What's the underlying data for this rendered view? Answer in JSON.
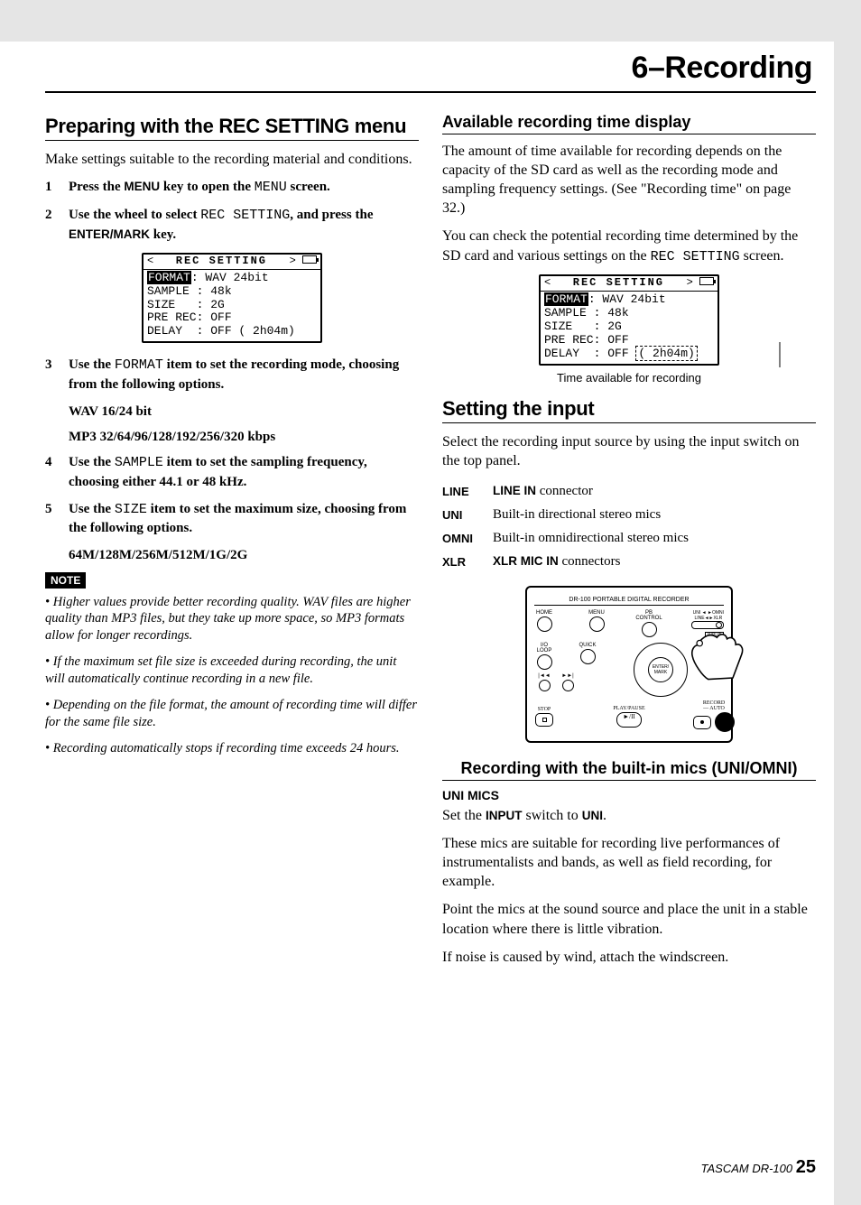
{
  "chapter": "6–Recording",
  "left": {
    "h2": "Preparing with the REC SETTING menu",
    "intro": "Make settings suitable to the recording material and conditions.",
    "step1_a": "Press the ",
    "step1_menu": "MENU",
    "step1_b": " key to open the ",
    "step1_screen": "MENU",
    "step1_c": " screen.",
    "step2_a": "Use the wheel to select ",
    "step2_rec": "REC SETTING",
    "step2_b": ", and press the ",
    "step2_enter": "ENTER/MARK",
    "step2_c": " key.",
    "step3_a": "Use the ",
    "step3_fmt": "FORMAT",
    "step3_b": " item to set the recording mode, choosing from the following options.",
    "sub_wav": "WAV 16/24 bit",
    "sub_mp3": "MP3 32/64/96/128/192/256/320 kbps",
    "step4_a": "Use the ",
    "step4_smp": "SAMPLE",
    "step4_b": " item to set the sampling frequency, choosing either 44.1 or 48 kHz.",
    "step5_a": "Use the ",
    "step5_sz": "SIZE",
    "step5_b": " item to set the maximum size, choosing from the following options.",
    "sub_size": "64M/128M/256M/512M/1G/2G",
    "note_tag": "NOTE",
    "note1": "• Higher values provide better recording quality. WAV files are higher quality than MP3 files, but they take up more space, so MP3 formats allow for longer recordings.",
    "note2": "• If the maximum set file size is exceeded during recording, the unit will automatically continue recording in a new file.",
    "note3": "• Depending on the file format, the amount of recording time will differ for the same file size.",
    "note4": "• Recording automatically stops if recording time exceeds 24 hours."
  },
  "lcd": {
    "title": "REC SETTING",
    "r_format_k": "FORMAT",
    "r_format_v": ": WAV 24bit",
    "r_sample": "SAMPLE : 48k",
    "r_size": "SIZE   : 2G",
    "r_prerec": "PRE REC: OFF",
    "r_delay": "DELAY  : OFF ( 2h04m)",
    "r_delay_hl": "DELAY  : OFF ",
    "r_delay_box": "( 2h04m)"
  },
  "right": {
    "h3_avail": "Available recording time display",
    "p_avail1": "The amount of time available for recording depends on the capacity of the SD card as well as the recording mode and sampling frequency settings. (See \"Recording time\" on page 32.)",
    "p_avail2_a": "You can check the potential recording time determined by the SD card and various settings on the ",
    "p_avail2_rec": "REC SETTING",
    "p_avail2_b": " screen.",
    "caption": "Time available for recording",
    "h2_input": "Setting the input",
    "p_input": "Select the recording input source by using the input switch on the top panel.",
    "tbl": {
      "line_k": "LINE",
      "line_v_a": "LINE IN",
      "line_v_b": " connector",
      "uni_k": "UNI",
      "uni_v": "Built-in directional stereo mics",
      "omni_k": "OMNI",
      "omni_v": "Built-in omnidirectional stereo mics",
      "xlr_k": "XLR",
      "xlr_v_a": "XLR MIC IN",
      "xlr_v_b": " connectors"
    },
    "device_title": "DR-100 PORTABLE DIGITAL RECORDER",
    "device_labels": {
      "home": "HOME",
      "menu": "MENU",
      "pb": "PB CONTROL",
      "switch": "UNI ◄ ►OMNI\nLINE◄►XLR",
      "input": "INPUT",
      "ioloop": "I/O LOOP",
      "quick": "QUICK",
      "enter": "ENTER/\nMARK",
      "rew": "◄◄",
      "ff": "►►",
      "stop": "STOP",
      "play": "PLAY/PAUSE",
      "record": "RECORD",
      "auto": "AUTO"
    },
    "h3_rec": "Recording with the built-in mics (UNI/OMNI)",
    "uni_head": "UNI MICS",
    "p_uni1_a": "Set the ",
    "p_uni1_input": "INPUT",
    "p_uni1_b": " switch to ",
    "p_uni1_uni": "UNI",
    "p_uni1_c": ".",
    "p_uni2": "These mics are suitable for recording live performances of instrumentalists and bands, as well as field recording, for example.",
    "p_uni3": "Point the mics at the sound source and place the unit in a stable location where there is little vibration.",
    "p_uni4": "If noise is caused by wind, attach the windscreen."
  },
  "footer_model": "TASCAM  DR-100",
  "footer_page": "25"
}
